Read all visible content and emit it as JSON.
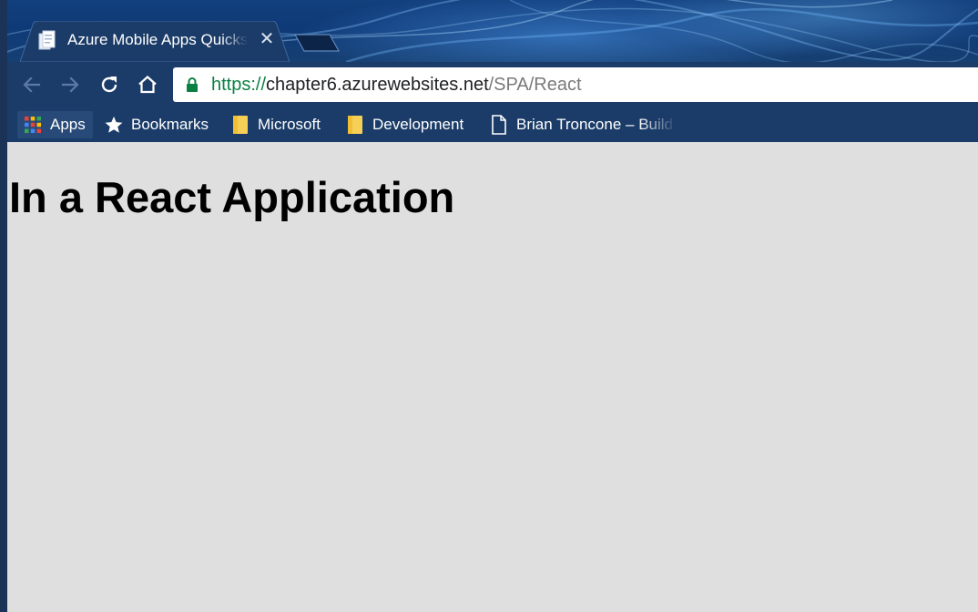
{
  "browser": {
    "tab": {
      "title": "Azure Mobile Apps Quickstart",
      "favicon": "page-document-icon",
      "close_glyph": "✕"
    },
    "toolbar": {
      "back_icon": "arrow-left-icon",
      "forward_icon": "arrow-right-icon",
      "reload_icon": "reload-icon",
      "home_icon": "home-icon",
      "secure_icon": "lock-icon"
    },
    "address_bar": {
      "scheme": "https://",
      "host": "chapter6.azurewebsites.net",
      "path": "/SPA/React"
    },
    "bookmarks": [
      {
        "label": "Apps",
        "icon": "apps-grid-icon"
      },
      {
        "label": "Bookmarks",
        "icon": "star-icon"
      },
      {
        "label": "Microsoft",
        "icon": "folder-icon"
      },
      {
        "label": "Development",
        "icon": "folder-icon"
      },
      {
        "label": "Brian Troncone – Build",
        "icon": "page-icon"
      }
    ]
  },
  "page": {
    "heading": "In a React Application"
  },
  "colors": {
    "frame": "#1b3c68",
    "page_background": "#dfdfdf",
    "secure_green": "#0b8043",
    "url_path_gray": "#7a7a7a",
    "folder_yellow": "#f6cf57"
  }
}
